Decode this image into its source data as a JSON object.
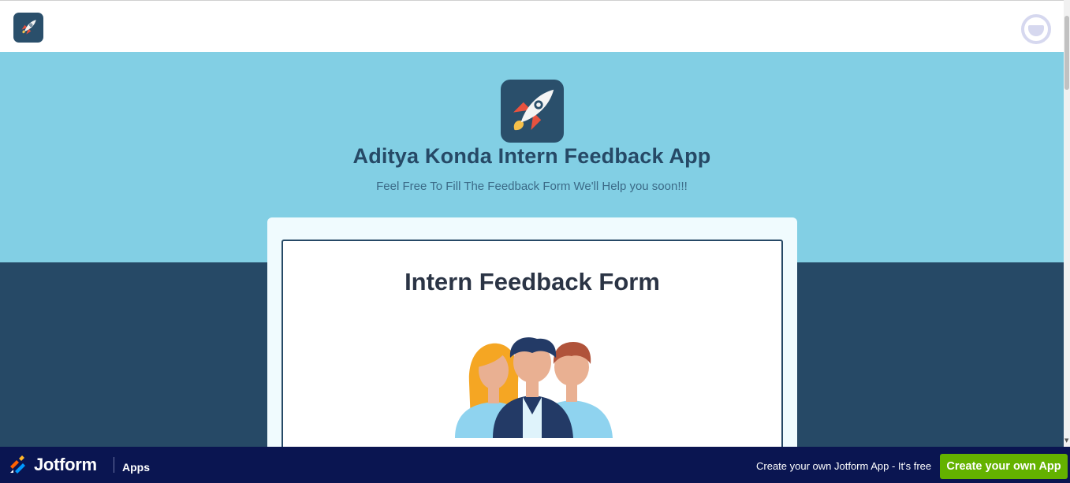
{
  "header": {
    "app_icon": "rocket-icon",
    "avatar_icon": "user-avatar-icon"
  },
  "hero": {
    "app_icon": "rocket-icon",
    "title": "Aditya Konda Intern Feedback App",
    "subtitle": "Feel Free To Fill The Feedback Form We'll Help you soon!!!"
  },
  "form": {
    "title": "Intern Feedback Form",
    "illustration": "team-people-illustration"
  },
  "footer": {
    "brand": "Jotform",
    "section": "Apps",
    "promo": "Create your own Jotform App - It's free",
    "cta_label": "Create your own App"
  },
  "colors": {
    "hero_bg": "#82cfe4",
    "lower_bg": "#264966",
    "title_color": "#264966",
    "footer_bg": "#0a1551",
    "cta_bg": "#64b200"
  }
}
